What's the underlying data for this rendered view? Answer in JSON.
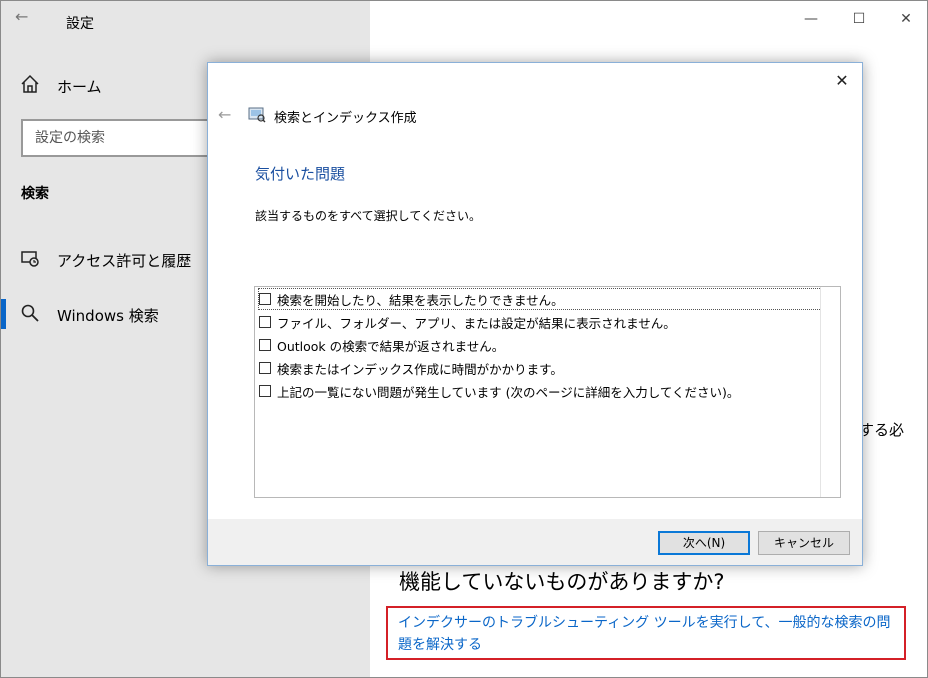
{
  "settings": {
    "title": "設定",
    "back_glyph": "←",
    "nav_home": "ホーム",
    "search_placeholder": "設定の検索",
    "section": "検索",
    "nav_items": [
      {
        "label": "アクセス許可と履歴",
        "icon": "permissions-history-icon"
      },
      {
        "label": "Windows 検索",
        "icon": "search-icon",
        "active": true
      }
    ],
    "window_controls": {
      "minimize": "—",
      "maximize": "☐",
      "close": "✕"
    }
  },
  "right_pane": {
    "partial_text": "する必",
    "heading": "機能していないものがありますか?",
    "link": "インデクサーのトラブルシューティング ツールを実行して、一般的な検索の問題を解決する",
    "accent": "#0a66c8",
    "highlight_border": "#d42027"
  },
  "dialog": {
    "close": "✕",
    "back": "←",
    "title": "検索とインデックス作成",
    "heading": "気付いた問題",
    "instruction": "該当するものをすべて選択してください。",
    "problems": [
      {
        "label": "検索を開始したり、結果を表示したりできません。",
        "checked": false
      },
      {
        "label": "ファイル、フォルダー、アプリ、または設定が結果に表示されません。",
        "checked": false
      },
      {
        "label": "Outlook の検索で結果が返されません。",
        "checked": false
      },
      {
        "label": "検索またはインデックス作成に時間がかかります。",
        "checked": false
      },
      {
        "label": "上記の一覧にない問題が発生しています (次のページに詳細を入力してください)。",
        "checked": false
      }
    ],
    "next_button": "次へ(N)",
    "cancel_button": "キャンセル"
  }
}
